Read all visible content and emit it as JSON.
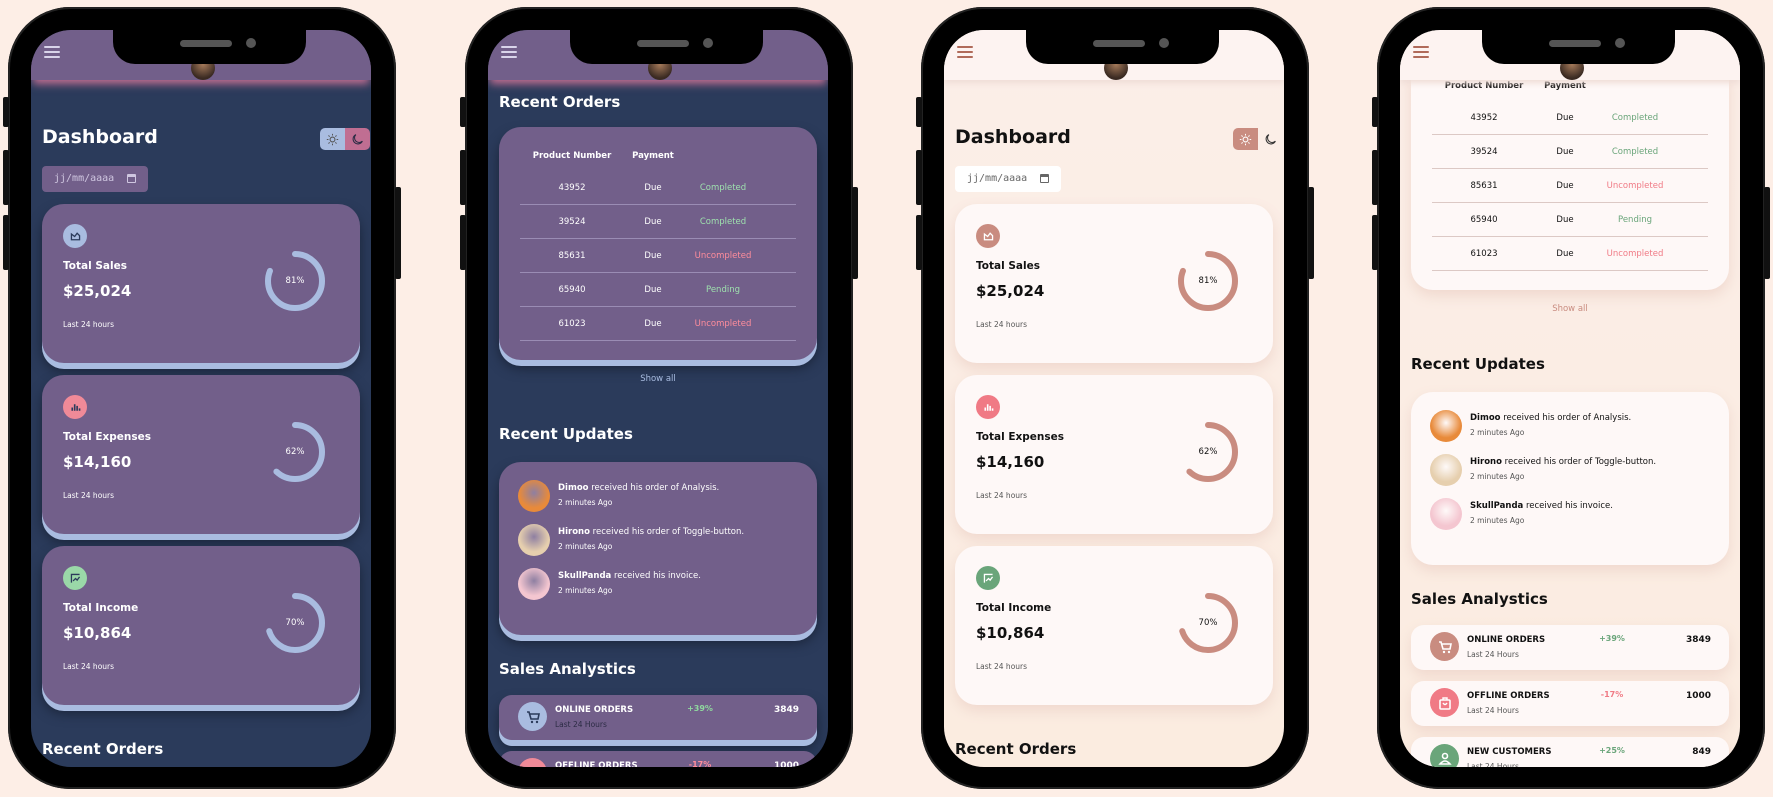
{
  "phones": [
    {
      "theme": "dark"
    },
    {
      "theme": "dark"
    },
    {
      "theme": "light"
    },
    {
      "theme": "light"
    }
  ],
  "colors": {
    "dark_bg": "#2b3b5b",
    "dark_card": "#725f8a",
    "dark_accent": "#a9bce0",
    "dark_pink": "#c06e92",
    "light_bg": "#fbeee2",
    "light_card": "#fef8f7",
    "light_accent": "#c98c80",
    "green": "#76c78f",
    "red": "#f07a85"
  },
  "header": {
    "menu_icon": "hamburger-icon",
    "avatar": "profile-avatar"
  },
  "dashboard": {
    "title": "Dashboard",
    "theme_toggle": {
      "light_icon": "sun-icon",
      "dark_icon": "moon-icon"
    },
    "date_placeholder": "jj/mm/aaaa",
    "cards": [
      {
        "label": "Total Sales",
        "value": "$25,024",
        "sub": "Last 24 hours",
        "percent": 81,
        "percent_label": "81%",
        "icon": "chart-area-icon",
        "icon_color": "#a9bce0",
        "icon_color_light": "#c98c80"
      },
      {
        "label": "Total Expenses",
        "value": "$14,160",
        "sub": "Last 24 hours",
        "percent": 62,
        "percent_label": "62%",
        "icon": "bar-chart-icon",
        "icon_color": "#f08a98",
        "icon_color_light": "#f07a85"
      },
      {
        "label": "Total Income",
        "value": "$10,864",
        "sub": "Last 24 hours",
        "percent": 70,
        "percent_label": "70%",
        "icon": "stock-icon",
        "icon_color": "#9ad8a8",
        "icon_color_light": "#6aa57a"
      }
    ]
  },
  "orders": {
    "title": "Recent Orders",
    "columns": [
      "Product Number",
      "Payment",
      ""
    ],
    "rows": [
      {
        "number": "43952",
        "payment": "Due",
        "status": "Completed",
        "state": "ok"
      },
      {
        "number": "39524",
        "payment": "Due",
        "status": "Completed",
        "state": "ok"
      },
      {
        "number": "85631",
        "payment": "Due",
        "status": "Uncompleted",
        "state": "bad"
      },
      {
        "number": "65940",
        "payment": "Due",
        "status": "Pending",
        "state": "ok"
      },
      {
        "number": "61023",
        "payment": "Due",
        "status": "Uncompleted",
        "state": "bad"
      }
    ],
    "show_all": "Show all"
  },
  "updates": {
    "title": "Recent Updates",
    "items": [
      {
        "name": "Dimoo",
        "text": " received his order of Analysis.",
        "time": "2 minutes Ago",
        "avatar_color": "#e88a3a"
      },
      {
        "name": "Hirono",
        "text": " received his order of Toggle-button.",
        "time": "2 minutes Ago",
        "avatar_color": "#e6cfae"
      },
      {
        "name": "SkullPanda",
        "text": " received his invoice.",
        "time": "2 minutes Ago",
        "avatar_color": "#f4c6d0"
      }
    ]
  },
  "analytics": {
    "title": "Sales Analystics",
    "items": [
      {
        "name": "ONLINE ORDERS",
        "sub": "Last 24 Hours",
        "change": "+39%",
        "value": "3849",
        "trend": "up",
        "icon": "cart-icon",
        "icon_color": "#a9bce0",
        "icon_color_light": "#c98c80"
      },
      {
        "name": "OFFLINE ORDERS",
        "sub": "Last 24 Hours",
        "change": "-17%",
        "value": "1000",
        "trend": "down",
        "icon": "shopping-bag-icon",
        "icon_color": "#f08a98",
        "icon_color_light": "#f07a85"
      },
      {
        "name": "NEW CUSTOMERS",
        "sub": "Last 24 Hours",
        "change": "+25%",
        "value": "849",
        "trend": "up",
        "icon": "person-icon",
        "icon_color": "#9ad8a8",
        "icon_color_light": "#6aa57a"
      }
    ]
  }
}
